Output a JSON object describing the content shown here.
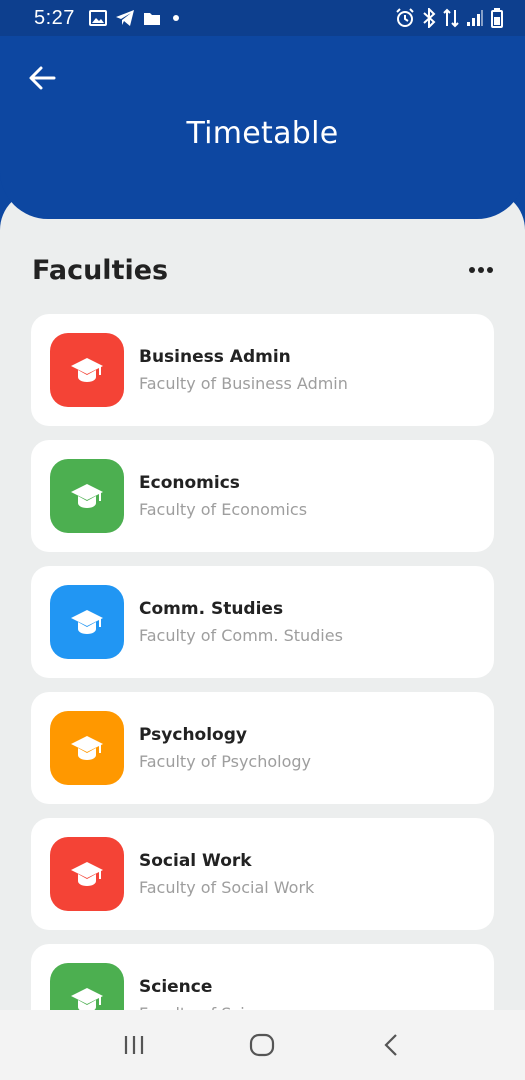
{
  "status_bar": {
    "time": "5:27",
    "left_icons": [
      "image-icon",
      "telegram-icon",
      "folder-icon",
      "dot-icon"
    ],
    "right_icons": [
      "alarm-icon",
      "bluetooth-icon",
      "data-arrows-icon",
      "signal-icon",
      "battery-icon"
    ]
  },
  "app_bar": {
    "title": "Timetable",
    "back_icon": "arrow-left-icon",
    "color": "#0d47a1"
  },
  "section": {
    "title": "Faculties",
    "menu_icon": "more-horizontal-icon"
  },
  "faculties": [
    {
      "name": "Business Admin",
      "subtitle": "Faculty of Business Admin",
      "color": "#f44336",
      "icon": "graduation-cap-icon"
    },
    {
      "name": "Economics",
      "subtitle": "Faculty of Economics",
      "color": "#4caf50",
      "icon": "graduation-cap-icon"
    },
    {
      "name": "Comm. Studies",
      "subtitle": "Faculty of Comm. Studies",
      "color": "#2196f3",
      "icon": "graduation-cap-icon"
    },
    {
      "name": "Psychology",
      "subtitle": "Faculty of Psychology",
      "color": "#ff9800",
      "icon": "graduation-cap-icon"
    },
    {
      "name": "Social Work",
      "subtitle": "Faculty of Social Work",
      "color": "#f44336",
      "icon": "graduation-cap-icon"
    },
    {
      "name": "Science",
      "subtitle": "Faculty of Science",
      "color": "#4caf50",
      "icon": "graduation-cap-icon"
    }
  ],
  "nav_bar": {
    "buttons": [
      "recent-apps-icon",
      "home-icon",
      "back-icon"
    ]
  }
}
